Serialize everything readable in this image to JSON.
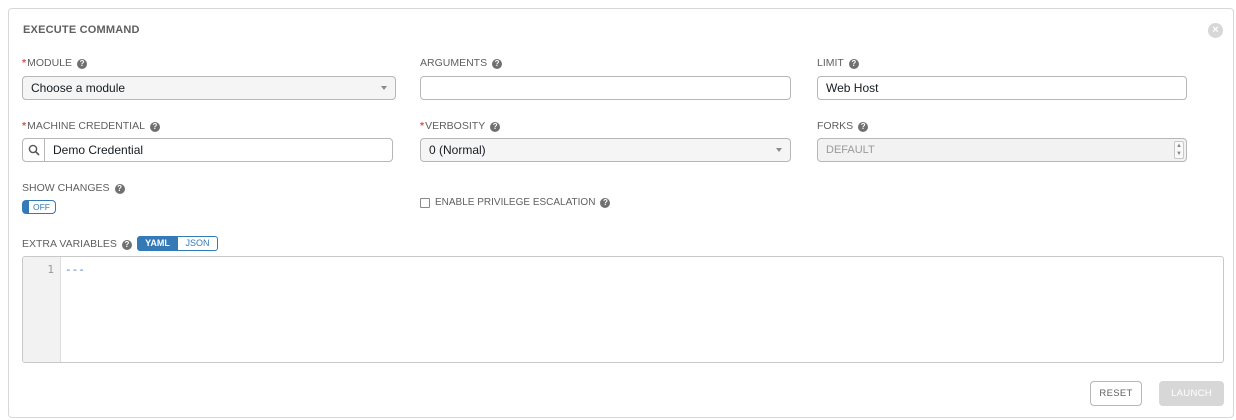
{
  "panel": {
    "title": "EXECUTE COMMAND",
    "close_icon": "close-icon"
  },
  "fields": {
    "module": {
      "required": "*",
      "label": "MODULE",
      "value": "Choose a module",
      "help": "?"
    },
    "arguments": {
      "label": "ARGUMENTS",
      "value": "",
      "help": "?"
    },
    "limit": {
      "label": "LIMIT",
      "value": "Web Host",
      "help": "?"
    },
    "machine_credential": {
      "required": "*",
      "label": "MACHINE CREDENTIAL",
      "value": "Demo Credential",
      "help": "?",
      "icon": "search-icon"
    },
    "verbosity": {
      "required": "*",
      "label": "VERBOSITY",
      "value": "0 (Normal)",
      "help": "?"
    },
    "forks": {
      "label": "FORKS",
      "placeholder": "DEFAULT",
      "help": "?"
    },
    "show_changes": {
      "label": "SHOW CHANGES",
      "help": "?",
      "toggle_text": "OFF"
    },
    "privilege_escalation": {
      "label": "ENABLE PRIVILEGE ESCALATION",
      "help": "?",
      "checked": false
    },
    "extra_variables": {
      "label": "EXTRA VARIABLES",
      "help": "?",
      "modes": [
        "YAML",
        "JSON"
      ],
      "selected_mode": "YAML",
      "line_number": "1",
      "content": "---"
    }
  },
  "buttons": {
    "reset": "RESET",
    "launch": "LAUNCH"
  },
  "colors": {
    "accent": "#337ab7",
    "required": "#d9534f",
    "disabled": "#d7d7d7"
  }
}
